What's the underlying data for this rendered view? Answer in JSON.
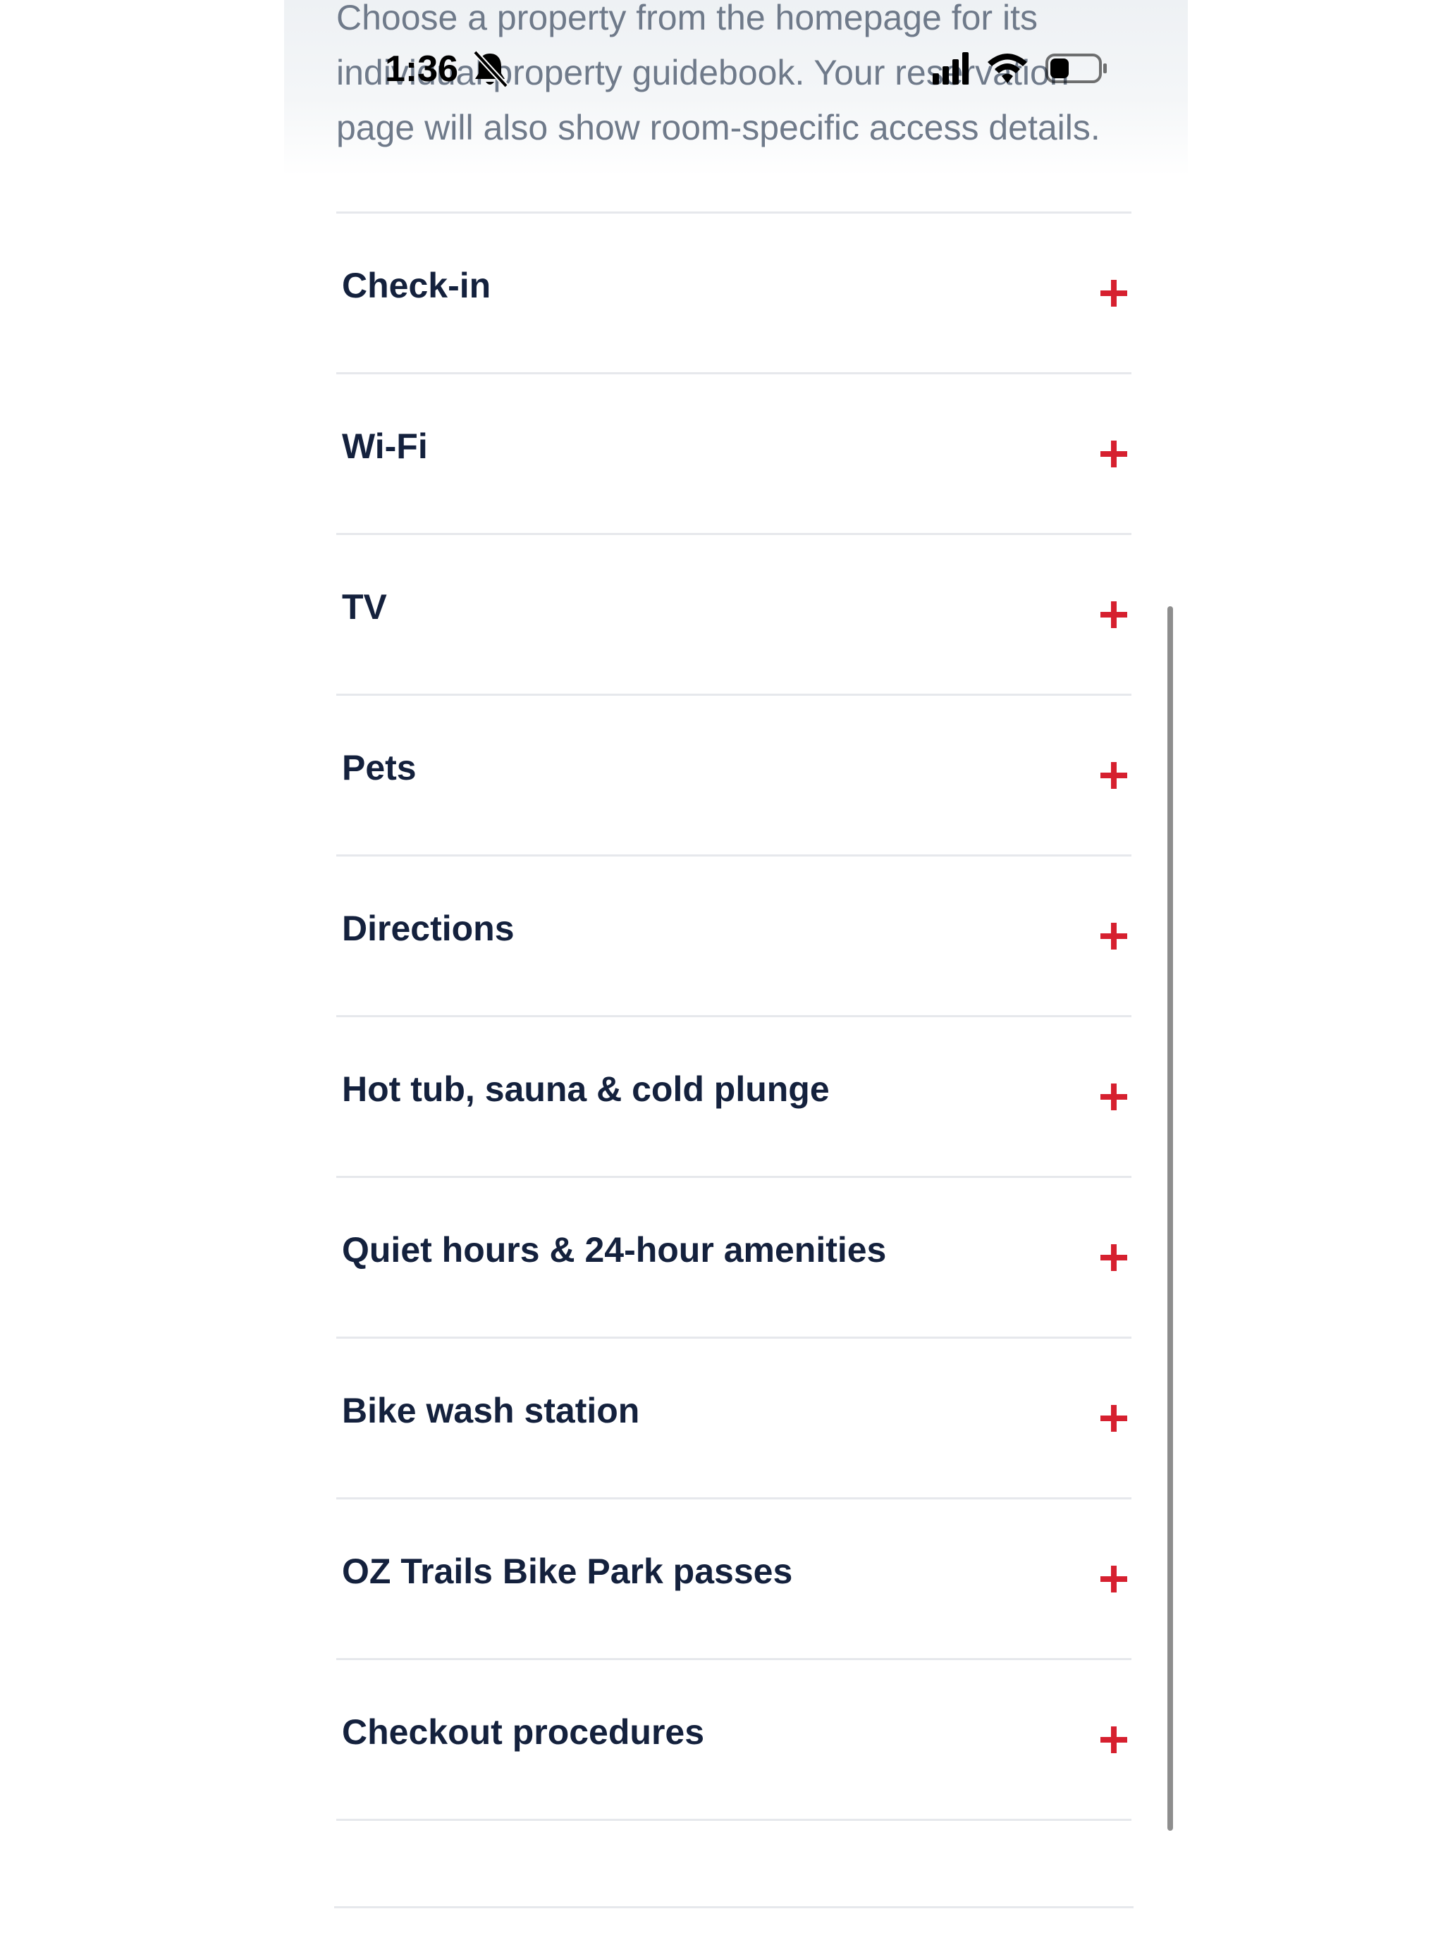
{
  "status_bar": {
    "time": "1:36",
    "icons": [
      "bell-slash-icon",
      "signal-icon",
      "wifi-icon",
      "battery-icon"
    ]
  },
  "intro": {
    "text": "Choose a property from the homepage for its individual property guidebook. Your reservation page will also show room-specific access details."
  },
  "accordion": {
    "items": [
      {
        "label": "Check-in",
        "icon": "plus-icon"
      },
      {
        "label": "Wi-Fi",
        "icon": "plus-icon"
      },
      {
        "label": "TV",
        "icon": "plus-icon"
      },
      {
        "label": "Pets",
        "icon": "plus-icon"
      },
      {
        "label": "Directions",
        "icon": "plus-icon"
      },
      {
        "label": "Hot tub, sauna & cold plunge",
        "icon": "plus-icon"
      },
      {
        "label": "Quiet hours & 24-hour amenities",
        "icon": "plus-icon"
      },
      {
        "label": "Bike wash station",
        "icon": "plus-icon"
      },
      {
        "label": "OZ Trails Bike Park passes",
        "icon": "plus-icon"
      },
      {
        "label": "Checkout procedures",
        "icon": "plus-icon"
      }
    ]
  },
  "colors": {
    "heading": "#14213d",
    "intro_text": "#6f7a8a",
    "accent_plus": "#d6202f",
    "divider": "#e6e8ec",
    "scrollbar": "#8e8e8e"
  }
}
